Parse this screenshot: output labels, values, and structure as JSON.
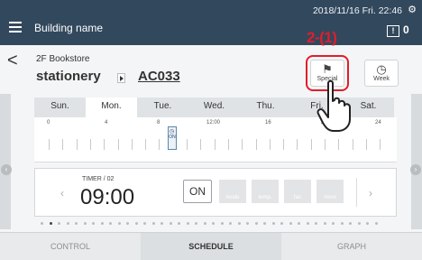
{
  "header": {
    "building": "Building name",
    "datetime": "2018/11/16 Fri. 22:46",
    "status_count": "0",
    "status_icon": "alert-icon"
  },
  "title": {
    "floor": "2F Bookstore",
    "category": "stationery",
    "unit": "AC033"
  },
  "modes": [
    {
      "label": "Special",
      "icon": "flag-icon"
    },
    {
      "label": "Week",
      "icon": "calendar-icon"
    }
  ],
  "annotation": "2-(1)",
  "days": [
    "Sun.",
    "Mon.",
    "Tue.",
    "Wed.",
    "Thu.",
    "Fri.",
    "Sat."
  ],
  "timeline": {
    "hours": [
      "0",
      "4",
      "8",
      "12:00",
      "16",
      "20",
      "24"
    ],
    "marker": "ON"
  },
  "event": {
    "timer_label": "TIMER / 02",
    "time": "09:00",
    "state": "ON",
    "options": [
      "mode",
      "temp.",
      "fan",
      "more"
    ]
  },
  "bottom_nav": [
    "CONTROL",
    "SCHEDULE",
    "GRAPH"
  ],
  "colors": {
    "header_bg": "#32485d",
    "accent_red": "#e21d2b"
  }
}
